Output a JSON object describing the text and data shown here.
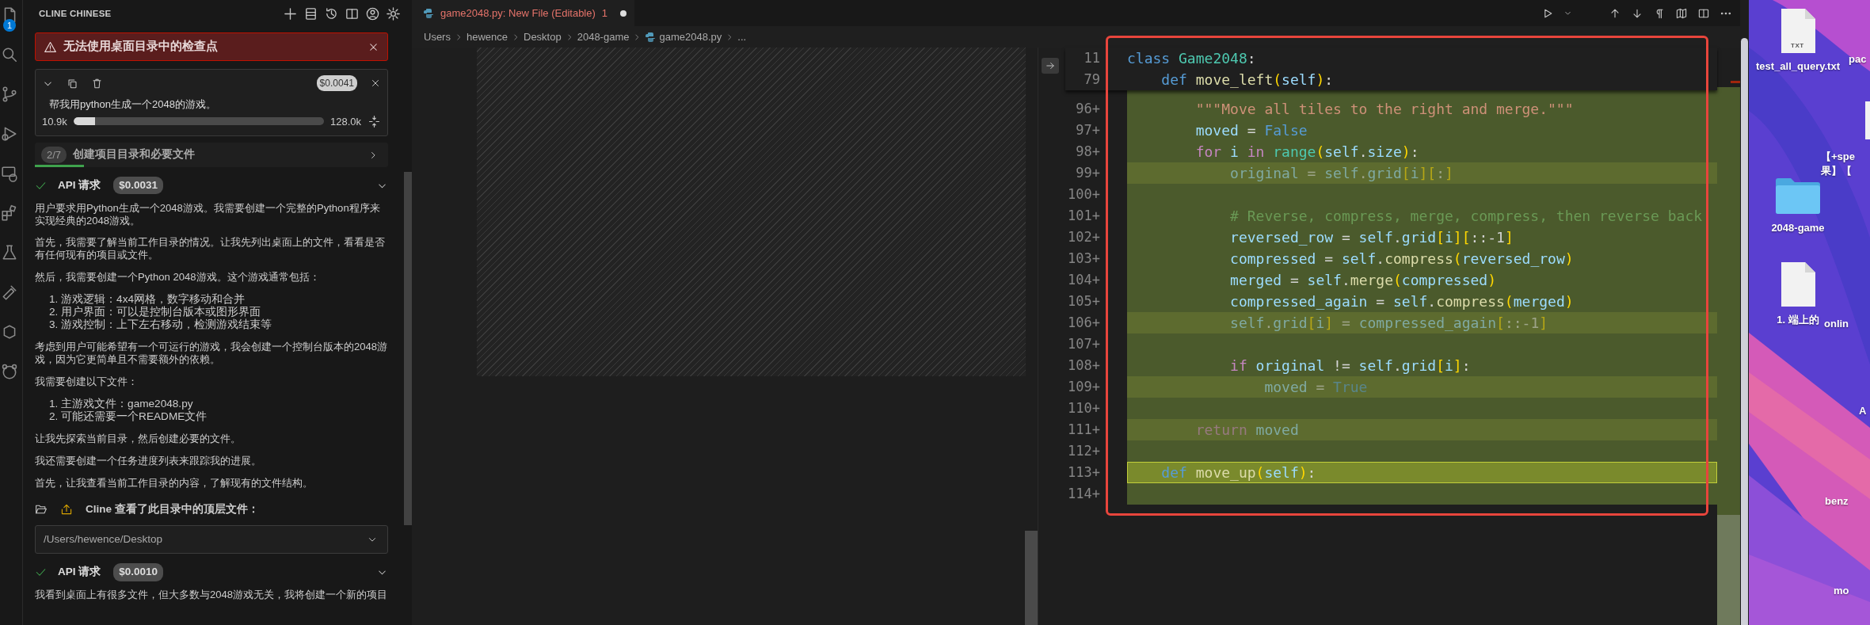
{
  "activity_bar": {
    "badge": "1"
  },
  "sidebar": {
    "title": "CLINE CHINESE",
    "error_banner": {
      "text": "无法使用桌面目录中的检查点"
    },
    "task": {
      "cost": "$0.0041",
      "text": "帮我用python生成一个2048的游戏。",
      "tokens_used": "10.9k",
      "context_window": "128.0k",
      "level": 0.085
    },
    "todo": {
      "count": "2/7",
      "text": "创建项目目录和必要文件",
      "level": 0.14
    },
    "messages": [
      {
        "kind": "api",
        "title": "API 请求",
        "cost": "$0.0031",
        "done": true
      },
      {
        "kind": "paragraph",
        "text": "用户要求用Python生成一个2048游戏。我需要创建一个完整的Python程序来实现经典的2048游戏。"
      },
      {
        "kind": "paragraph",
        "text": "首先，我需要了解当前工作目录的情况。让我先列出桌面上的文件，看看是否有任何现有的项目或文件。"
      },
      {
        "kind": "paragraph",
        "text": "然后，我需要创建一个Python 2048游戏。这个游戏通常包括："
      },
      {
        "kind": "list",
        "items": [
          "1. 游戏逻辑：4x4网格，数字移动和合并",
          "2. 用户界面：可以是控制台版本或图形界面",
          "3. 游戏控制：上下左右移动，检测游戏结束等"
        ]
      },
      {
        "kind": "paragraph",
        "text": "考虑到用户可能希望有一个可运行的游戏，我会创建一个控制台版本的2048游戏，因为它更简单且不需要额外的依赖。"
      },
      {
        "kind": "paragraph",
        "text": "我需要创建以下文件："
      },
      {
        "kind": "list",
        "items": [
          "1. 主游戏文件：game2048.py",
          "2. 可能还需要一个README文件"
        ]
      },
      {
        "kind": "paragraph",
        "text": "让我先探索当前目录，然后创建必要的文件。"
      },
      {
        "kind": "paragraph",
        "text": "我还需要创建一个任务进度列表来跟踪我的进展。"
      },
      {
        "kind": "paragraph",
        "text": "首先，让我查看当前工作目录的内容，了解现有的文件结构。"
      },
      {
        "kind": "tool",
        "text": "Cline 查看了此目录中的顶层文件："
      },
      {
        "kind": "path",
        "value": "/Users/hewence/Desktop"
      },
      {
        "kind": "api",
        "title": "API 请求",
        "cost": "$0.0010",
        "done": true
      },
      {
        "kind": "paragraph",
        "text": "我看到桌面上有很多文件，但大多数与2048游戏无关，我将创建一个新的项目"
      }
    ]
  },
  "editor": {
    "tab": {
      "label": "game2048.py: New File (Editable)",
      "problems": "1",
      "modified": true,
      "selected": true
    },
    "breadcrumb": [
      {
        "label": "Users",
        "kind": "folder"
      },
      {
        "label": "hewence",
        "kind": "folder"
      },
      {
        "label": "Desktop",
        "kind": "folder"
      },
      {
        "label": "2048-game",
        "kind": "folder"
      },
      {
        "label": "game2048.py",
        "kind": "file"
      },
      {
        "label": "...",
        "kind": "more"
      }
    ],
    "sticky": [
      {
        "number": "11",
        "tokens": [
          {
            "text": "class ",
            "kind": "keyword"
          },
          {
            "text": "Game2048",
            "kind": "type"
          },
          {
            "text": ":",
            "kind": "plain"
          }
        ]
      },
      {
        "number": "79",
        "tokens": [
          {
            "text": "    def ",
            "kind": "keyword"
          },
          {
            "text": "move_left",
            "kind": "function"
          },
          {
            "text": "(",
            "kind": "bracket"
          },
          {
            "text": "self",
            "kind": "variable"
          },
          {
            "text": ")",
            "kind": "bracket"
          },
          {
            "text": ":",
            "kind": "plain"
          }
        ]
      }
    ],
    "lines": [
      {
        "number": "96+",
        "kind": "added",
        "tokens": [
          {
            "text": "        \"\"\"Move all tiles to the right and merge.\"\"\"",
            "kind": "string"
          }
        ]
      },
      {
        "number": "97+",
        "kind": "added",
        "tokens": [
          {
            "text": "        moved",
            "kind": "variable"
          },
          {
            "text": " = ",
            "kind": "plain"
          },
          {
            "text": "False",
            "kind": "keyword"
          }
        ]
      },
      {
        "number": "98+",
        "kind": "added",
        "tokens": [
          {
            "text": "        for",
            "kind": "control"
          },
          {
            "text": " i ",
            "kind": "variable"
          },
          {
            "text": "in ",
            "kind": "control"
          },
          {
            "text": "range",
            "kind": "type"
          },
          {
            "text": "(",
            "kind": "bracket"
          },
          {
            "text": "self",
            "kind": "variable"
          },
          {
            "text": ".",
            "kind": "plain"
          },
          {
            "text": "size",
            "kind": "variable"
          },
          {
            "text": ")",
            "kind": "bracket"
          },
          {
            "text": ":",
            "kind": "plain"
          }
        ]
      },
      {
        "number": "99+",
        "kind": "faded",
        "tokens": [
          {
            "text": "            original",
            "kind": "variable"
          },
          {
            "text": " = ",
            "kind": "plain"
          },
          {
            "text": "self",
            "kind": "variable"
          },
          {
            "text": ".",
            "kind": "plain"
          },
          {
            "text": "grid",
            "kind": "variable"
          },
          {
            "text": "[",
            "kind": "bracket"
          },
          {
            "text": "i",
            "kind": "variable"
          },
          {
            "text": "][",
            "kind": "bracket"
          },
          {
            "text": ":",
            "kind": "plain"
          },
          {
            "text": "]",
            "kind": "bracket"
          }
        ]
      },
      {
        "number": "100+",
        "kind": "added"
      },
      {
        "number": "101+",
        "kind": "added",
        "tokens": [
          {
            "text": "            # Reverse, compress, merge, compress, then reverse back",
            "kind": "comment"
          }
        ]
      },
      {
        "number": "102+",
        "kind": "added",
        "tokens": [
          {
            "text": "            reversed_row",
            "kind": "variable"
          },
          {
            "text": " = ",
            "kind": "plain"
          },
          {
            "text": "self",
            "kind": "variable"
          },
          {
            "text": ".",
            "kind": "plain"
          },
          {
            "text": "grid",
            "kind": "variable"
          },
          {
            "text": "[",
            "kind": "bracket"
          },
          {
            "text": "i",
            "kind": "variable"
          },
          {
            "text": "][",
            "kind": "bracket"
          },
          {
            "text": "::-1",
            "kind": "plain"
          },
          {
            "text": "]",
            "kind": "bracket"
          }
        ]
      },
      {
        "number": "103+",
        "kind": "added",
        "tokens": [
          {
            "text": "            compressed",
            "kind": "variable"
          },
          {
            "text": " = ",
            "kind": "plain"
          },
          {
            "text": "self",
            "kind": "variable"
          },
          {
            "text": ".",
            "kind": "plain"
          },
          {
            "text": "compress",
            "kind": "function"
          },
          {
            "text": "(",
            "kind": "bracket"
          },
          {
            "text": "reversed_row",
            "kind": "variable"
          },
          {
            "text": ")",
            "kind": "bracket"
          }
        ]
      },
      {
        "number": "104+",
        "kind": "added",
        "tokens": [
          {
            "text": "            merged",
            "kind": "variable"
          },
          {
            "text": " = ",
            "kind": "plain"
          },
          {
            "text": "self",
            "kind": "variable"
          },
          {
            "text": ".",
            "kind": "plain"
          },
          {
            "text": "merge",
            "kind": "function"
          },
          {
            "text": "(",
            "kind": "bracket"
          },
          {
            "text": "compressed",
            "kind": "variable"
          },
          {
            "text": ")",
            "kind": "bracket"
          }
        ]
      },
      {
        "number": "105+",
        "kind": "added",
        "tokens": [
          {
            "text": "            compressed_again",
            "kind": "variable"
          },
          {
            "text": " = ",
            "kind": "plain"
          },
          {
            "text": "self",
            "kind": "variable"
          },
          {
            "text": ".",
            "kind": "plain"
          },
          {
            "text": "compress",
            "kind": "function"
          },
          {
            "text": "(",
            "kind": "bracket"
          },
          {
            "text": "merged",
            "kind": "variable"
          },
          {
            "text": ")",
            "kind": "bracket"
          }
        ]
      },
      {
        "number": "106+",
        "kind": "faded",
        "tokens": [
          {
            "text": "            self",
            "kind": "variable"
          },
          {
            "text": ".",
            "kind": "plain"
          },
          {
            "text": "grid",
            "kind": "variable"
          },
          {
            "text": "[",
            "kind": "bracket"
          },
          {
            "text": "i",
            "kind": "variable"
          },
          {
            "text": "]",
            "kind": "bracket"
          },
          {
            "text": " = ",
            "kind": "plain"
          },
          {
            "text": "compressed_again",
            "kind": "variable"
          },
          {
            "text": "[",
            "kind": "bracket"
          },
          {
            "text": "::-1",
            "kind": "plain"
          },
          {
            "text": "]",
            "kind": "bracket"
          }
        ]
      },
      {
        "number": "107+",
        "kind": "added"
      },
      {
        "number": "108+",
        "kind": "added",
        "tokens": [
          {
            "text": "            if",
            "kind": "control"
          },
          {
            "text": " original ",
            "kind": "variable"
          },
          {
            "text": "!= ",
            "kind": "plain"
          },
          {
            "text": "self",
            "kind": "variable"
          },
          {
            "text": ".",
            "kind": "plain"
          },
          {
            "text": "grid",
            "kind": "variable"
          },
          {
            "text": "[",
            "kind": "bracket"
          },
          {
            "text": "i",
            "kind": "variable"
          },
          {
            "text": "]",
            "kind": "bracket"
          },
          {
            "text": ":",
            "kind": "plain"
          }
        ]
      },
      {
        "number": "109+",
        "kind": "faded",
        "tokens": [
          {
            "text": "                moved",
            "kind": "variable"
          },
          {
            "text": " = ",
            "kind": "plain"
          },
          {
            "text": "True",
            "kind": "keyword"
          }
        ]
      },
      {
        "number": "110+",
        "kind": "added"
      },
      {
        "number": "111+",
        "kind": "faded",
        "tokens": [
          {
            "text": "        return",
            "kind": "control"
          },
          {
            "text": " moved",
            "kind": "variable"
          }
        ]
      },
      {
        "number": "112+",
        "kind": "added"
      },
      {
        "number": "113+",
        "kind": "current",
        "tokens": [
          {
            "text": "    def ",
            "kind": "keyword"
          },
          {
            "text": "move_up",
            "kind": "function"
          },
          {
            "text": "(",
            "kind": "bracket"
          },
          {
            "text": "self",
            "kind": "variable"
          },
          {
            "text": ")",
            "kind": "bracket"
          },
          {
            "text": ":",
            "kind": "plain"
          }
        ]
      },
      {
        "number": "114+",
        "kind": "added"
      }
    ]
  },
  "desktop": {
    "items": [
      {
        "label": "test_all_query.txt",
        "kind": "text-file",
        "icon_text": "TXT"
      },
      {
        "label": "2048-game",
        "kind": "folder"
      },
      {
        "label": "1. 端上的",
        "kind": "document"
      }
    ],
    "cut_labels": [
      "pac",
      "【+spe",
      "果】【",
      "onlin",
      "A",
      "benz",
      "mo"
    ]
  }
}
